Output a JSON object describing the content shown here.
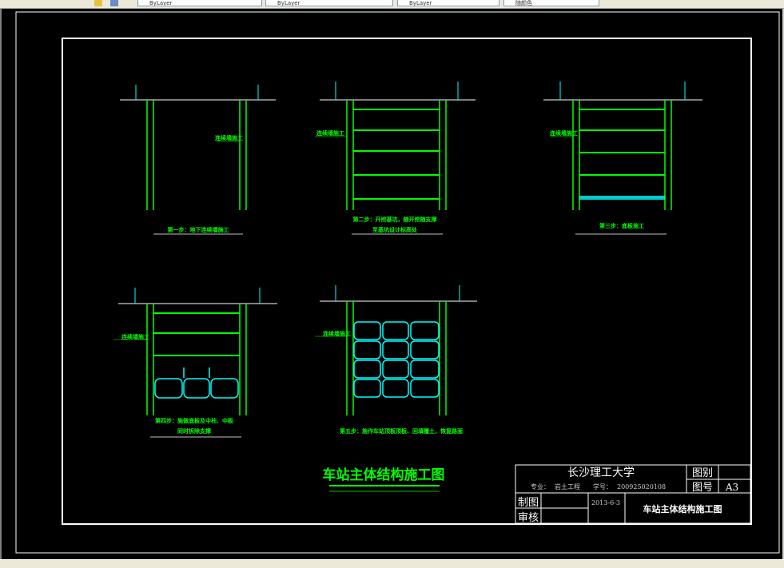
{
  "toolbar": {
    "layer_1": "ByLayer",
    "layer_2": "ByLayer",
    "layer_3": "ByLayer",
    "color_field": "随颜色"
  },
  "drawing": {
    "title": "车站主体结构施工图",
    "wall_label": "连续墙施工",
    "steps": [
      {
        "line1": "第一步：地下连续墙施工",
        "line2": ""
      },
      {
        "line1": "第二步：开挖基坑，随开挖随支撑",
        "line2": "至基坑设计标高处"
      },
      {
        "line1": "第三步：底板施工",
        "line2": ""
      },
      {
        "line1": "第四步：施做底板及中柱、中板",
        "line2": "同时拆除支撑"
      },
      {
        "line1": "第五步：施作车站顶板顶板、回填覆土，恢复路面",
        "line2": ""
      }
    ]
  },
  "title_block": {
    "school": "长沙理工大学",
    "major_label": "专业：",
    "major": "岩土工程",
    "id_label": "学号：",
    "student_id": "2009250201​08",
    "category_label": "图别",
    "number_label": "图号",
    "number_value": "A3",
    "draw_label": "制图",
    "review_label": "审核",
    "date": "2013-6-3",
    "drawing_name": "车站主体结构施工图"
  },
  "colors": {
    "wall": "#00ff00",
    "strut": "#00ff00",
    "structure": "#00ffff",
    "text": "#00ff00",
    "frame": "#ffffff",
    "background": "#000000"
  }
}
